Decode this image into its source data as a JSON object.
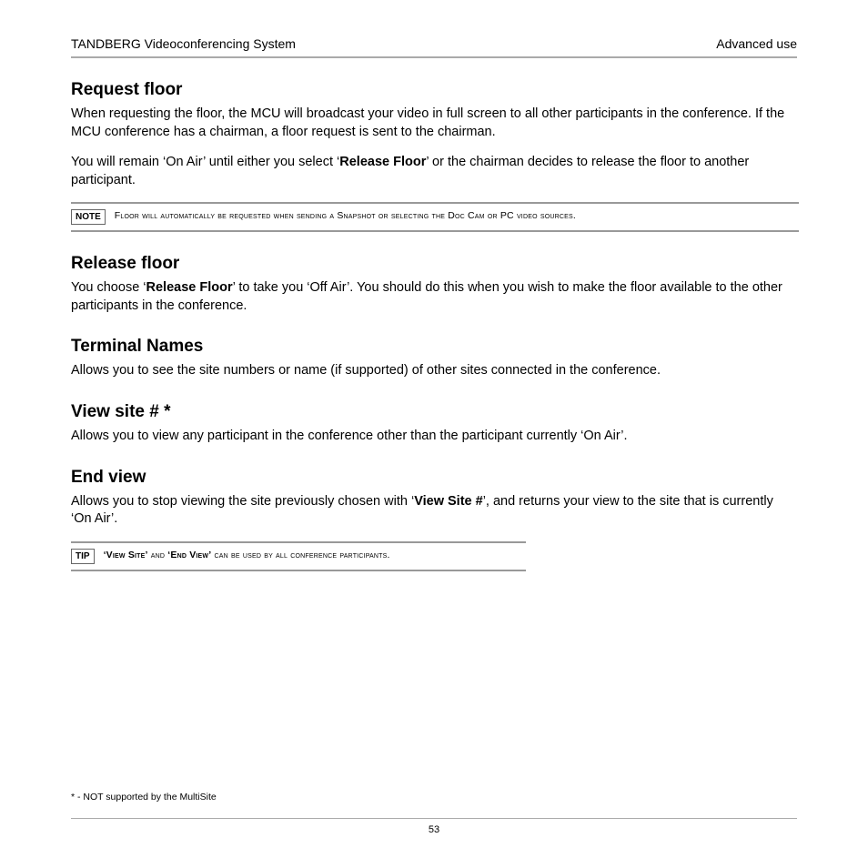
{
  "header": {
    "left": "TANDBERG Videoconferencing System",
    "right": "Advanced use"
  },
  "sections": {
    "s1": {
      "title": "Request floor",
      "p1a": "When requesting the floor, the MCU will broadcast your video in full screen to all other participants in the conference. If the MCU conference has a chairman, a floor request is sent to the chairman.",
      "p2_pre": "You will remain ‘On Air’ until either you select ‘",
      "p2_bold": "Release Floor",
      "p2_post": "’ or the chairman decides to release the floor to another participant."
    },
    "note1": {
      "tag": "NOTE",
      "text": "Floor will automatically be requested when sending a Snapshot or selecting the Doc Cam or PC video sources."
    },
    "s2": {
      "title": "Release floor",
      "p1_pre": "You choose ‘",
      "p1_bold": "Release Floor",
      "p1_post": "’ to take you ‘Off Air’. You should do this when you wish to make the floor available to the other participants in the conference."
    },
    "s3": {
      "title": "Terminal Names",
      "p1": "Allows you to see the site numbers or name (if supported) of other sites connected in the conference."
    },
    "s4": {
      "title": "View site # *",
      "p1": "Allows you to view any participant in the conference other than the participant currently ‘On Air’."
    },
    "s5": {
      "title": "End view",
      "p1_pre": "Allows you to stop viewing the site previously chosen with ‘",
      "p1_bold": "View Site #",
      "p1_post": "’, and returns your view to the site that is currently ‘On Air’."
    },
    "tip1": {
      "tag": "TIP",
      "t1": "‘View Site’",
      "t2": " and ",
      "t3": "‘End View’",
      "t4": " can be used by all conference participants."
    }
  },
  "footnote": "* - NOT supported by the MultiSite",
  "pagenum": "53"
}
